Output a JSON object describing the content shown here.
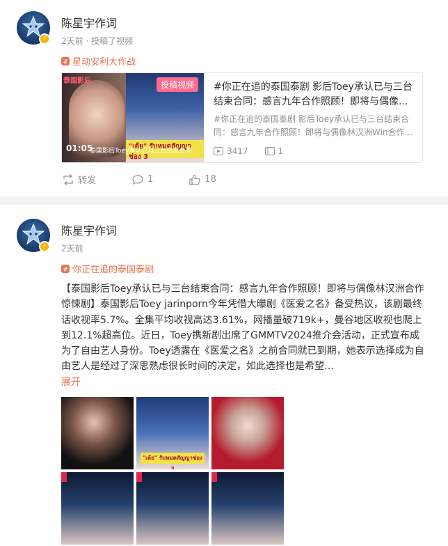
{
  "post1": {
    "username": "陈星宇作词",
    "meta": "2天前 · 投稿了视频",
    "topic": "星动安利大作战",
    "repost": {
      "title": "#你正在追的泰国泰剧 影后Toey承认已与三台结束合同：感言九年合作照顾！即将与偶像...",
      "desc": "#你正在追的泰国泰剧 影后Toey承认已与三台结束合同：感言九年合作照顾！即将与偶像林汉洲Win合作...",
      "thumb_tag": "投稿视频",
      "thumb_top": "泰国影后",
      "duration": "01:05",
      "caption": "泰国影后Toey承认已与三台结束合同",
      "thai_text": "\"เต้ย\" รับหมดสัญญาช่อง 3",
      "views": "3417",
      "collections": "1"
    },
    "actions": {
      "repost": "转发",
      "comments": "1",
      "likes": "18"
    }
  },
  "post2": {
    "username": "陈星宇作词",
    "meta": "2天前",
    "topic": "你正在追的泰国泰剧",
    "text": "【泰国影后Toey承认已与三台结束合同：感言九年合作照顾！即将与偶像林汉洲合作惊悚剧】泰国影后Toey jarinporn今年凭借大曝剧《医爱之名》备受热议，该剧最终话收视率5.7%。全集平均收视高达3.61%，网播量破719k+，曼谷地区收视也爬上到12.1%超高位。近日，Toey携新剧出席了GMMTV2024推介会活动，正式宣布成为了自由艺人身份。Toey透露在《医爱之名》之前合同就已到期，她表示选择成为自由艺人是经过了深思熟虑很长时间的决定，如此选择也是希望…",
    "more": "展开",
    "photo_band": "\"เต้ย\" รับหมดสัญญาช่อง 3"
  },
  "colors": {
    "accent": "#eb7350",
    "meta": "#939393",
    "badge": "#f7b500"
  }
}
